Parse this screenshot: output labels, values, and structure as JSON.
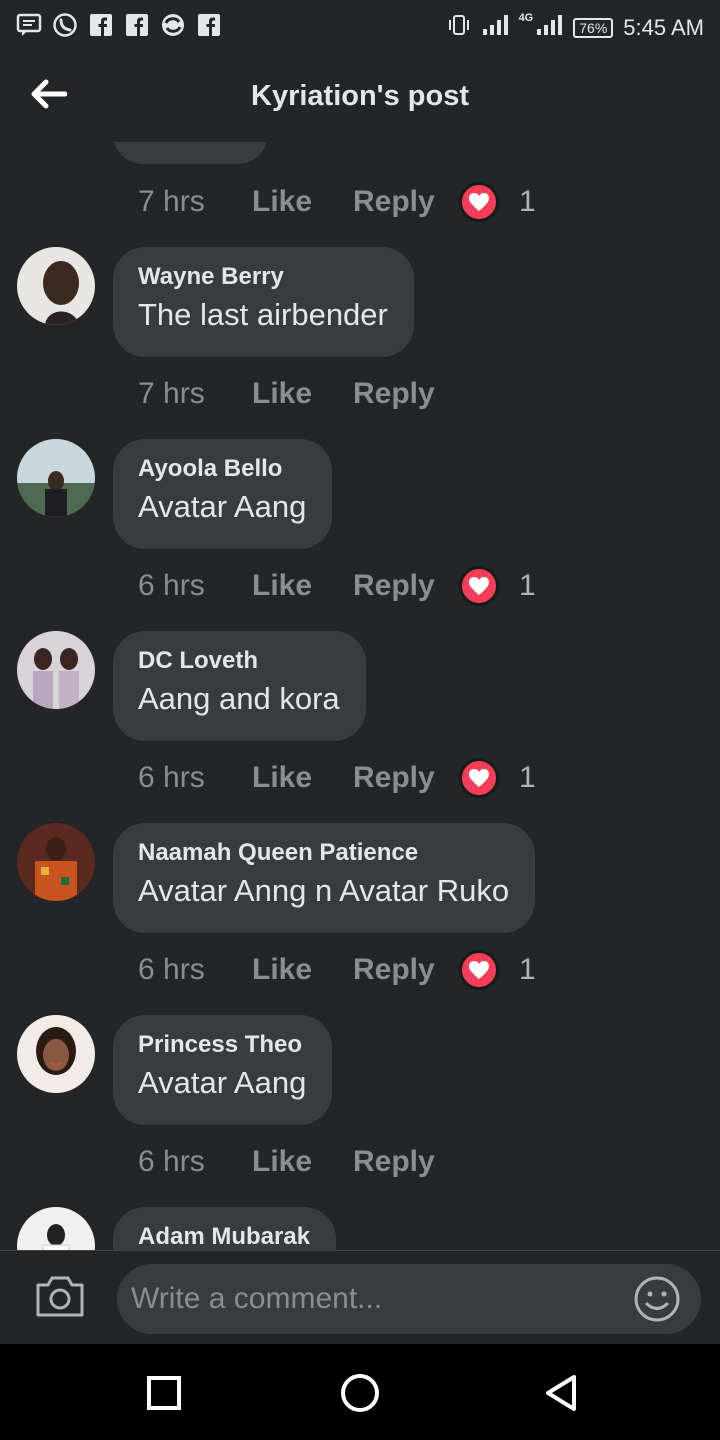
{
  "status_bar": {
    "battery": "76%",
    "time": "5:45 AM",
    "network": "4G"
  },
  "header": {
    "title": "Kyriation's post"
  },
  "first_meta": {
    "time_ago": "7 hrs",
    "like_label": "Like",
    "reply_label": "Reply",
    "reaction_count": "1"
  },
  "comments": [
    {
      "author": "Wayne Berry",
      "text": "The last airbender",
      "time_ago": "7 hrs",
      "like_label": "Like",
      "reply_label": "Reply",
      "reaction_count": ""
    },
    {
      "author": "Ayoola Bello",
      "text": "Avatar Aang",
      "time_ago": "6 hrs",
      "like_label": "Like",
      "reply_label": "Reply",
      "reaction_count": "1"
    },
    {
      "author": "DC Loveth",
      "text": "Aang and kora",
      "time_ago": "6 hrs",
      "like_label": "Like",
      "reply_label": "Reply",
      "reaction_count": "1"
    },
    {
      "author": "Naamah Queen Patience",
      "text": "Avatar Anng n Avatar Ruko",
      "time_ago": "6 hrs",
      "like_label": "Like",
      "reply_label": "Reply",
      "reaction_count": "1"
    },
    {
      "author": "Princess Theo",
      "text": "Avatar Aang",
      "time_ago": "6 hrs",
      "like_label": "Like",
      "reply_label": "Reply",
      "reaction_count": ""
    },
    {
      "author": "Adam Mubarak",
      "text": "",
      "time_ago": "",
      "like_label": "",
      "reply_label": "",
      "reaction_count": ""
    }
  ],
  "composer": {
    "placeholder": "Write a comment..."
  },
  "icons": {
    "back": "back-arrow-icon",
    "heart": "heart-icon",
    "camera": "camera-icon",
    "emoji": "emoji-icon",
    "nav_recent": "square-icon",
    "nav_home": "circle-icon",
    "nav_back": "triangle-icon"
  },
  "colors": {
    "background": "#242526",
    "bubble": "#3a3b3c",
    "text": "#e4e6eb",
    "muted": "#8a8d91",
    "heart": "#f33e58"
  }
}
